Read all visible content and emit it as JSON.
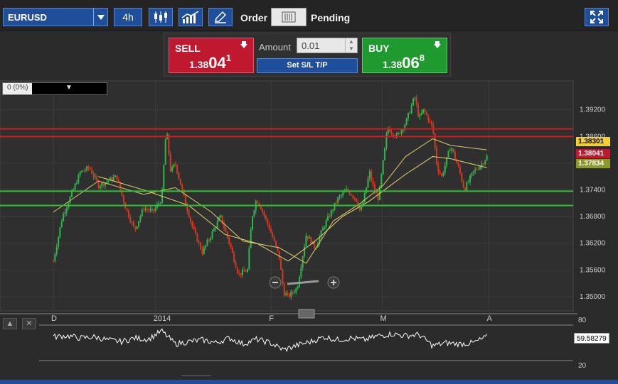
{
  "toolbar": {
    "symbol": "EURUSD",
    "timeframe": "4h",
    "order_label": "Order",
    "pending_label": "Pending",
    "icons": [
      "candlestick-icon",
      "indicators-icon",
      "draw-icon",
      "order-type-icon",
      "fullscreen-icon"
    ]
  },
  "order_panel": {
    "sell_label": "SELL",
    "sell_price_prefix": "1.38",
    "sell_price_big": "04",
    "sell_price_sup": "1",
    "buy_label": "BUY",
    "buy_price_prefix": "1.38",
    "buy_price_big": "06",
    "buy_price_sup": "8",
    "amount_label": "Amount",
    "amount_value": "0.01",
    "sltp_label": "Set S/L T/P"
  },
  "info_box": {
    "label": "0 (0%)"
  },
  "price_badges": [
    {
      "value": "1.38301",
      "color": "#f5d22b",
      "text_color": "#000000"
    },
    {
      "value": "1.38041",
      "color": "#c0182f",
      "text_color": "#ffffff"
    },
    {
      "value": "1.37834",
      "color": "#8a9a2a",
      "text_color": "#ffffff"
    }
  ],
  "oscillator": {
    "value": "59.58279",
    "level_high": "80",
    "level_low": "20"
  },
  "chart_data": {
    "type": "line",
    "x_ticks": [
      "D",
      "2014",
      "F",
      "M",
      "A"
    ],
    "y_ticks": [
      "1.39200",
      "1.38600",
      "1.38000",
      "1.37400",
      "1.36800",
      "1.36200",
      "1.35600",
      "1.35000"
    ],
    "ylim": [
      1.3468,
      1.3985
    ],
    "horizontal_lines": [
      {
        "value": 1.3877,
        "color": "#d41c1c"
      },
      {
        "value": 1.386,
        "color": "#d41c1c"
      },
      {
        "value": 1.3737,
        "color": "#2ec42e"
      },
      {
        "value": 1.3705,
        "color": "#2ec42e"
      }
    ],
    "colors": {
      "up": "#2db84a",
      "down": "#d9381e",
      "ma_fast": "#d8c86a",
      "ma_slow": "#e6d873"
    },
    "price_path": [
      [
        0.0,
        1.358
      ],
      [
        0.02,
        1.368
      ],
      [
        0.04,
        1.373
      ],
      [
        0.06,
        1.378
      ],
      [
        0.08,
        1.379
      ],
      [
        0.1,
        1.375
      ],
      [
        0.12,
        1.376
      ],
      [
        0.14,
        1.377
      ],
      [
        0.16,
        1.37
      ],
      [
        0.18,
        1.365
      ],
      [
        0.2,
        1.37
      ],
      [
        0.22,
        1.369
      ],
      [
        0.24,
        1.372
      ],
      [
        0.25,
        1.388
      ],
      [
        0.26,
        1.378
      ],
      [
        0.27,
        1.38
      ],
      [
        0.29,
        1.372
      ],
      [
        0.31,
        1.365
      ],
      [
        0.33,
        1.36
      ],
      [
        0.35,
        1.364
      ],
      [
        0.37,
        1.368
      ],
      [
        0.39,
        1.362
      ],
      [
        0.41,
        1.355
      ],
      [
        0.43,
        1.356
      ],
      [
        0.44,
        1.368
      ],
      [
        0.45,
        1.372
      ],
      [
        0.46,
        1.37
      ],
      [
        0.48,
        1.365
      ],
      [
        0.5,
        1.359
      ],
      [
        0.51,
        1.351
      ],
      [
        0.52,
        1.35
      ],
      [
        0.54,
        1.352
      ],
      [
        0.56,
        1.364
      ],
      [
        0.58,
        1.361
      ],
      [
        0.6,
        1.366
      ],
      [
        0.62,
        1.37
      ],
      [
        0.63,
        1.372
      ],
      [
        0.65,
        1.374
      ],
      [
        0.67,
        1.372
      ],
      [
        0.68,
        1.369
      ],
      [
        0.69,
        1.373
      ],
      [
        0.7,
        1.378
      ],
      [
        0.71,
        1.374
      ],
      [
        0.72,
        1.372
      ],
      [
        0.73,
        1.38
      ],
      [
        0.74,
        1.388
      ],
      [
        0.76,
        1.386
      ],
      [
        0.78,
        1.389
      ],
      [
        0.8,
        1.395
      ],
      [
        0.81,
        1.39
      ],
      [
        0.82,
        1.392
      ],
      [
        0.84,
        1.388
      ],
      [
        0.85,
        1.379
      ],
      [
        0.86,
        1.377
      ],
      [
        0.88,
        1.384
      ],
      [
        0.9,
        1.378
      ],
      [
        0.91,
        1.374
      ],
      [
        0.93,
        1.378
      ],
      [
        0.95,
        1.38
      ],
      [
        0.96,
        1.3815
      ]
    ],
    "ma_fast": [
      [
        0.0,
        1.369
      ],
      [
        0.1,
        1.376
      ],
      [
        0.2,
        1.373
      ],
      [
        0.27,
        1.3745
      ],
      [
        0.35,
        1.369
      ],
      [
        0.42,
        1.3625
      ],
      [
        0.5,
        1.361
      ],
      [
        0.56,
        1.3575
      ],
      [
        0.62,
        1.367
      ],
      [
        0.68,
        1.371
      ],
      [
        0.73,
        1.375
      ],
      [
        0.78,
        1.3815
      ],
      [
        0.84,
        1.3855
      ],
      [
        0.88,
        1.384
      ],
      [
        0.96,
        1.383
      ]
    ],
    "ma_slow": [
      [
        0.1,
        1.377
      ],
      [
        0.2,
        1.374
      ],
      [
        0.3,
        1.3705
      ],
      [
        0.38,
        1.364
      ],
      [
        0.45,
        1.362
      ],
      [
        0.52,
        1.358
      ],
      [
        0.58,
        1.3625
      ],
      [
        0.64,
        1.368
      ],
      [
        0.7,
        1.3715
      ],
      [
        0.78,
        1.3775
      ],
      [
        0.84,
        1.3815
      ],
      [
        0.88,
        1.381
      ],
      [
        0.96,
        1.379
      ]
    ],
    "oscillator_path": [
      [
        0.0,
        60
      ],
      [
        0.03,
        62
      ],
      [
        0.06,
        58
      ],
      [
        0.09,
        60
      ],
      [
        0.12,
        55
      ],
      [
        0.15,
        52
      ],
      [
        0.18,
        58
      ],
      [
        0.21,
        56
      ],
      [
        0.24,
        70
      ],
      [
        0.27,
        48
      ],
      [
        0.3,
        52
      ],
      [
        0.33,
        55
      ],
      [
        0.36,
        50
      ],
      [
        0.39,
        58
      ],
      [
        0.42,
        48
      ],
      [
        0.45,
        56
      ],
      [
        0.48,
        50
      ],
      [
        0.51,
        38
      ],
      [
        0.54,
        46
      ],
      [
        0.57,
        52
      ],
      [
        0.6,
        60
      ],
      [
        0.63,
        55
      ],
      [
        0.66,
        58
      ],
      [
        0.69,
        55
      ],
      [
        0.72,
        62
      ],
      [
        0.75,
        65
      ],
      [
        0.78,
        62
      ],
      [
        0.81,
        64
      ],
      [
        0.84,
        45
      ],
      [
        0.87,
        50
      ],
      [
        0.9,
        48
      ],
      [
        0.93,
        50
      ],
      [
        0.96,
        60
      ]
    ]
  }
}
